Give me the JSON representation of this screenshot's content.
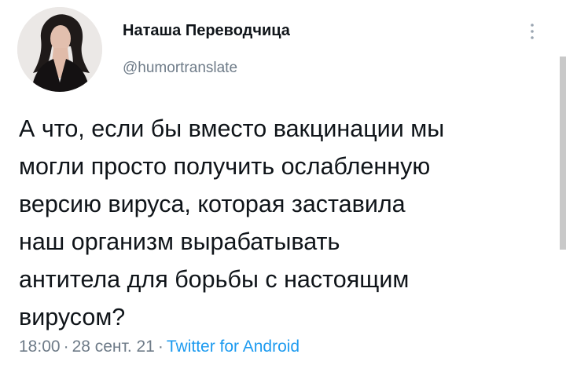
{
  "author": {
    "display_name": "Наташа Переводчица",
    "handle": "@humortranslate",
    "avatar_icon": "profile-photo"
  },
  "tweet": {
    "text": "А что, если бы вместо вакцинации мы\nмогли просто получить ослабленную\nверсию вируса, которая заставила\nнаш организм вырабатывать\nантитела для борьбы с настоящим\nвирусом?",
    "time": "18:00",
    "date": "28 сент. 21",
    "separator": "·",
    "source": "Twitter for Android"
  },
  "icons": {
    "more": "more-vertical-icon"
  },
  "colors": {
    "text": "#0f1419",
    "secondary": "#6e7b88",
    "link": "#1d9bf0",
    "background": "#ffffff"
  }
}
